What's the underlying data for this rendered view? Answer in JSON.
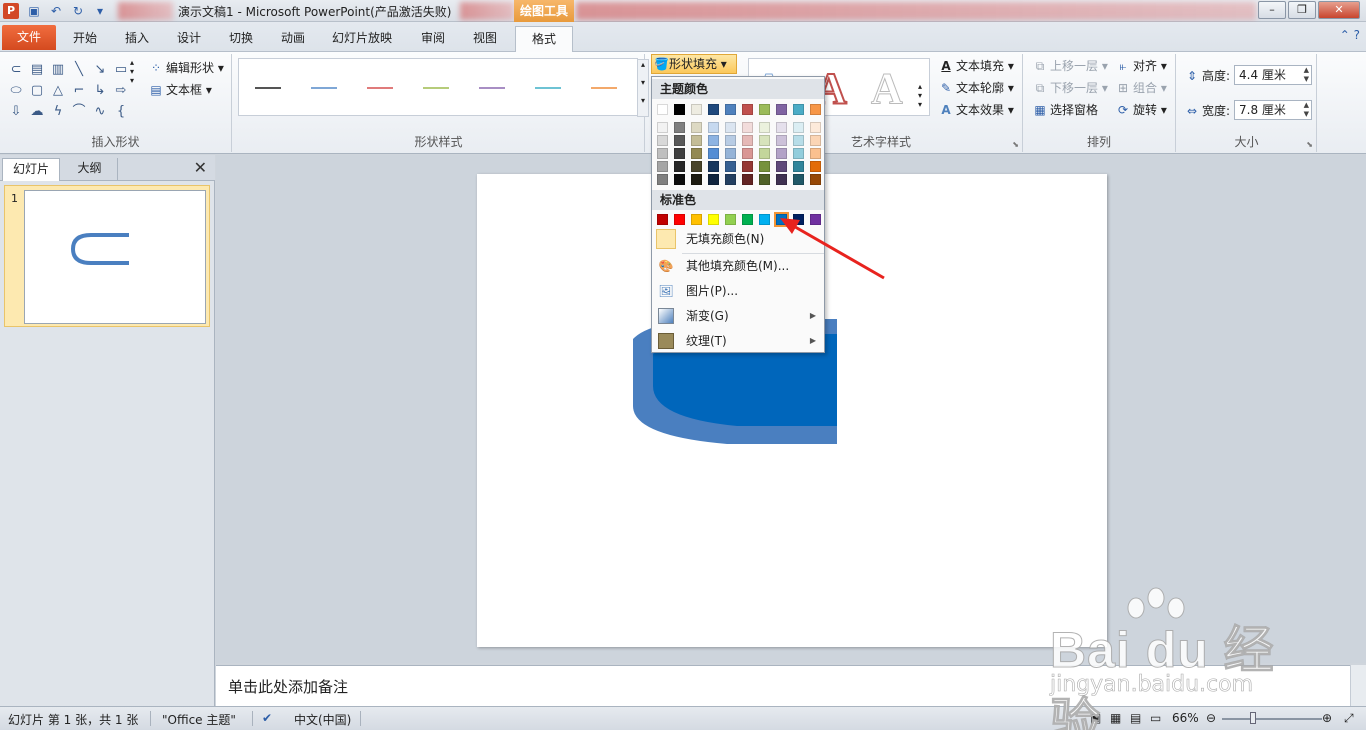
{
  "titlebar": {
    "window_title": "演示文稿1 - Microsoft PowerPoint(产品激活失败)",
    "context_tab": "绘图工具"
  },
  "tabs": [
    {
      "label": "文件"
    },
    {
      "label": "开始"
    },
    {
      "label": "插入"
    },
    {
      "label": "设计"
    },
    {
      "label": "切换"
    },
    {
      "label": "动画"
    },
    {
      "label": "幻灯片放映"
    },
    {
      "label": "审阅"
    },
    {
      "label": "视图"
    },
    {
      "label": "格式"
    }
  ],
  "ribbon": {
    "insert_shapes": {
      "label": "插入形状",
      "edit_shape": "编辑形状",
      "text_box": "文本框"
    },
    "shape_styles": {
      "label": "形状样式",
      "shape_fill": "形状填充",
      "line_colors": [
        "#555555",
        "#7fa7d6",
        "#e07b7b",
        "#b6cc7a",
        "#a88ec4",
        "#6ec3d4",
        "#f3a96b"
      ]
    },
    "wordart": {
      "label": "艺术字样式",
      "text_fill": "文本填充",
      "text_outline": "文本轮廓",
      "text_effects": "文本效果",
      "letters": [
        "A",
        "A",
        "A"
      ]
    },
    "arrange": {
      "label": "排列",
      "bring_forward": "上移一层",
      "send_backward": "下移一层",
      "selection_pane": "选择窗格",
      "align": "对齐",
      "group": "组合",
      "rotate": "旋转"
    },
    "size": {
      "label": "大小",
      "height_label": "高度:",
      "height_value": "4.4 厘米",
      "width_label": "宽度:",
      "width_value": "7.8 厘米"
    }
  },
  "left_panel": {
    "tab_slides": "幻灯片",
    "tab_outline": "大纲",
    "close": "✕",
    "slide_number": "1"
  },
  "notes_placeholder": "单击此处添加备注",
  "dropdown": {
    "theme_colors_header": "主题颜色",
    "standard_colors_header": "标准色",
    "theme_top_row": [
      "#ffffff",
      "#000000",
      "#eeece1",
      "#1f497d",
      "#4f81bd",
      "#c0504d",
      "#9bbb59",
      "#8064a2",
      "#4bacc6",
      "#f79646"
    ],
    "theme_shades": [
      [
        "#f2f2f2",
        "#7f7f7f",
        "#ddd9c3",
        "#c6d9f0",
        "#dbe5f1",
        "#f2dcdb",
        "#ebf1dd",
        "#e5e0ec",
        "#dbeef3",
        "#fdeada"
      ],
      [
        "#d8d8d8",
        "#595959",
        "#c4bd97",
        "#8db3e2",
        "#b8cce4",
        "#e5b9b7",
        "#d7e3bc",
        "#ccc1d9",
        "#b7dde8",
        "#fbd5b5"
      ],
      [
        "#bfbfbf",
        "#3f3f3f",
        "#938953",
        "#548dd4",
        "#95b3d7",
        "#d99694",
        "#c3d69b",
        "#b2a2c7",
        "#92cddc",
        "#fac08f"
      ],
      [
        "#a5a5a5",
        "#262626",
        "#494429",
        "#17365d",
        "#366092",
        "#953734",
        "#76923c",
        "#5f497a",
        "#31859b",
        "#e36c09"
      ],
      [
        "#7f7f7f",
        "#0c0c0c",
        "#1d1b10",
        "#0f243e",
        "#244061",
        "#632423",
        "#4f6128",
        "#3f3151",
        "#205867",
        "#974806"
      ]
    ],
    "standard_colors": [
      "#c00000",
      "#ff0000",
      "#ffc000",
      "#ffff00",
      "#92d050",
      "#00b050",
      "#00b0f0",
      "#0070c0",
      "#002060",
      "#7030a0"
    ],
    "selected_standard_index": 7,
    "no_fill": "无填充颜色(N)",
    "more_colors": "其他填充颜色(M)...",
    "picture": "图片(P)...",
    "gradient": "渐变(G)",
    "texture": "纹理(T)"
  },
  "statusbar": {
    "slide_info": "幻灯片 第 1 张，共 1 张",
    "theme": "\"Office 主题\"",
    "language": "中文(中国)",
    "zoom": "66%"
  },
  "watermark": {
    "brand": "Bai du 经验",
    "url": "jingyan.baidu.com"
  },
  "colors": {
    "accent": "#d24726",
    "shape_blue": "#0066bb",
    "shape_side": "#4a7fc0",
    "arrow_red": "#e8231e"
  }
}
